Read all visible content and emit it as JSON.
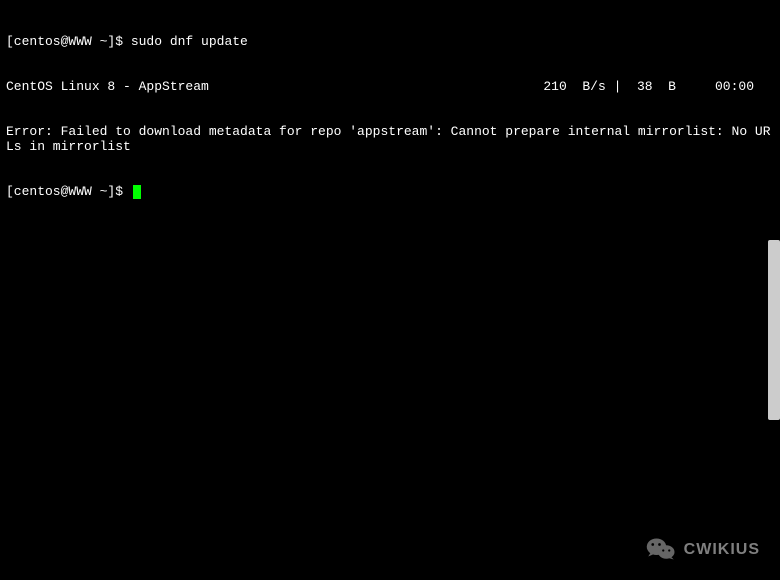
{
  "terminal": {
    "prompt1_prefix": "[centos@WWW ~]$ ",
    "command1": "sudo dnf update",
    "repo_line_left": "CentOS Linux 8 - AppStream",
    "repo_line_right": "210  B/s |  38  B     00:00",
    "error_line": "Error: Failed to download metadata for repo 'appstream': Cannot prepare internal mirrorlist: No URLs in mirrorlist",
    "prompt2_prefix": "[centos@WWW ~]$ "
  },
  "watermark": {
    "text": "CWIKIUS"
  }
}
